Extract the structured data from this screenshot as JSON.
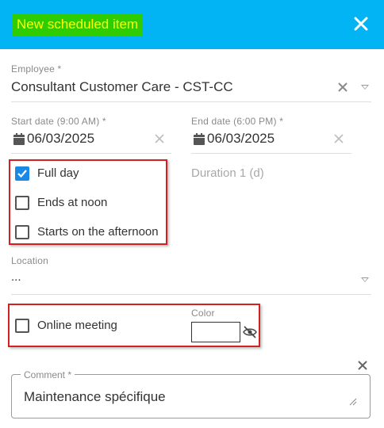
{
  "dialog": {
    "title": "New scheduled item",
    "close_icon": "close-icon"
  },
  "employee": {
    "label": "Employee *",
    "value": "Consultant Customer Care - CST-CC"
  },
  "start_date": {
    "label": "Start date (9:00 AM) *",
    "value": "06/03/2025"
  },
  "end_date": {
    "label": "End date (6:00 PM) *",
    "value": "06/03/2025"
  },
  "options": {
    "full_day": {
      "label": "Full day",
      "checked": true
    },
    "ends_at_noon": {
      "label": "Ends at noon",
      "checked": false
    },
    "starts_afternoon": {
      "label": "Starts on the afternoon",
      "checked": false
    }
  },
  "duration": {
    "text": "Duration 1 (d)"
  },
  "location": {
    "label": "Location",
    "value": "..."
  },
  "online_meeting": {
    "label": "Online meeting",
    "checked": false
  },
  "color": {
    "label": "Color",
    "value": ""
  },
  "comment": {
    "label": "Comment *",
    "value": "Maintenance spécifique"
  },
  "colors": {
    "header": "#03b4f4",
    "title_bg": "#2ecc00",
    "title_text": "#ffff00",
    "highlight_box": "#d61f1f",
    "checkbox_checked": "#1a88e6"
  }
}
